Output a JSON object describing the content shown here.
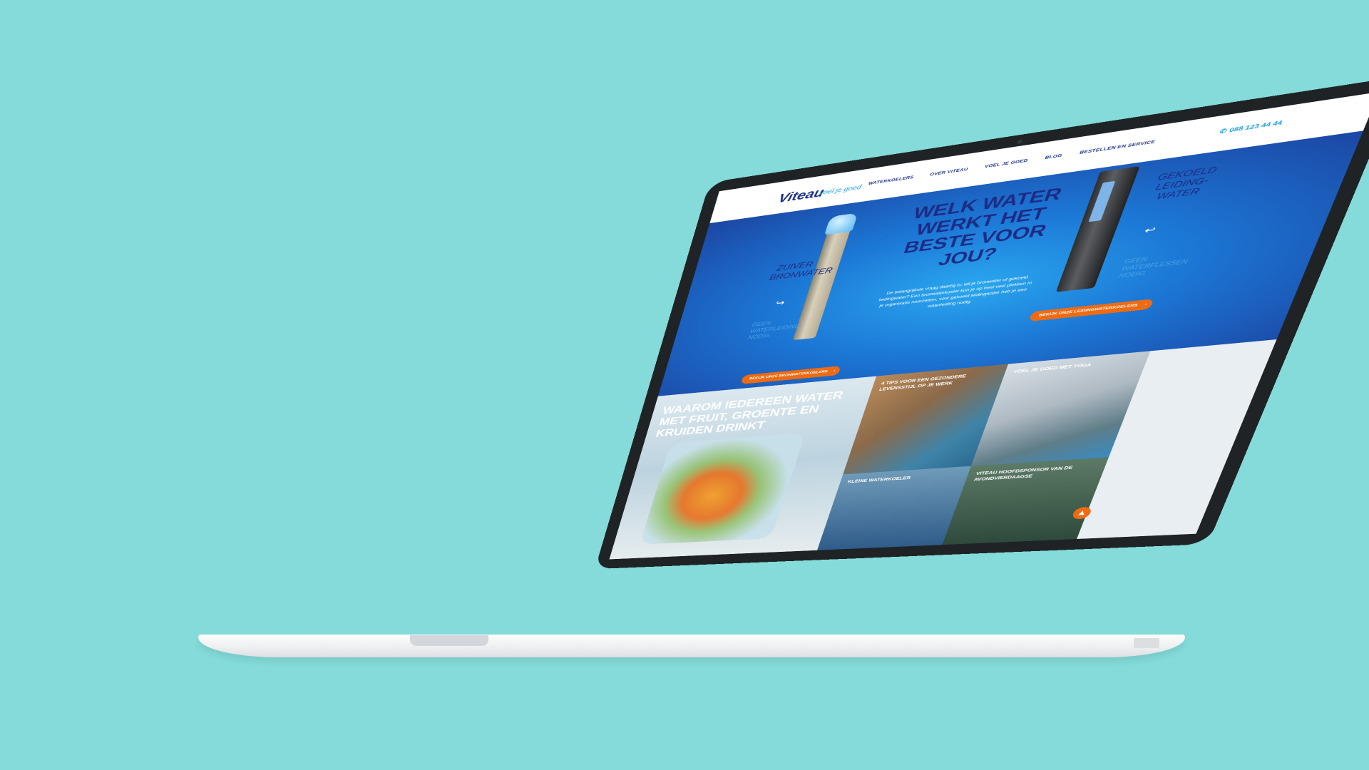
{
  "site": {
    "logo": "Viteau",
    "tagline": "voel je goed",
    "nav": [
      "WATERKOELERS",
      "OVER VITEAU",
      "VOEL JE GOED",
      "BLOG",
      "BESTELLEN EN SERVICE"
    ],
    "phone": "088 123 44 44"
  },
  "hero": {
    "title": "WELK WATER WERKT HET BESTE VOOR JOU?",
    "body": "De belangrijkste vraag daarbij is: wil je bronwater of gekoeld leidingwater? Een bronwaterkoeler kun je op heel veel plekken in je organisatie neerzetten, voor gekoeld leidingwater heb je een waterleiding nodig.",
    "left_label": "ZUIVER BRONWATER",
    "left_note": "GEEN WATERLEIDING NODIG",
    "right_label": "GEKOELD LEIDING-WATER",
    "right_note": "GEEN WATERFLESSEN NODIG",
    "cta_left": "BEKIJK ONZE BRONWATERKOELERS",
    "cta_right": "BEKIJK ONZE LEIDINGWATERKOELERS"
  },
  "tiles": {
    "main_title": "WAAROM IEDEREEN WATER MET FRUIT, GROENTE EN KRUIDEN DRINKT",
    "work": "4 TIPS VOOR EEN GEZONDERE LEVENSSTIJL OP JE WERK",
    "yoga": "VOEL JE GOED MET YOGA",
    "small": "KLEINE WATERKOELER",
    "sponsor": "VITEAU HOOFDSPONSOR VAN DE AVONDVIERDAAGSE"
  },
  "icons": {
    "phone": "phone-icon",
    "chevron": "chevron-right-icon",
    "up": "arrow-up-icon"
  },
  "colors": {
    "background": "#84dbd9",
    "brand_blue": "#1b2f86",
    "accent_orange": "#ee6b13",
    "light_blue": "#1b9fe0"
  }
}
